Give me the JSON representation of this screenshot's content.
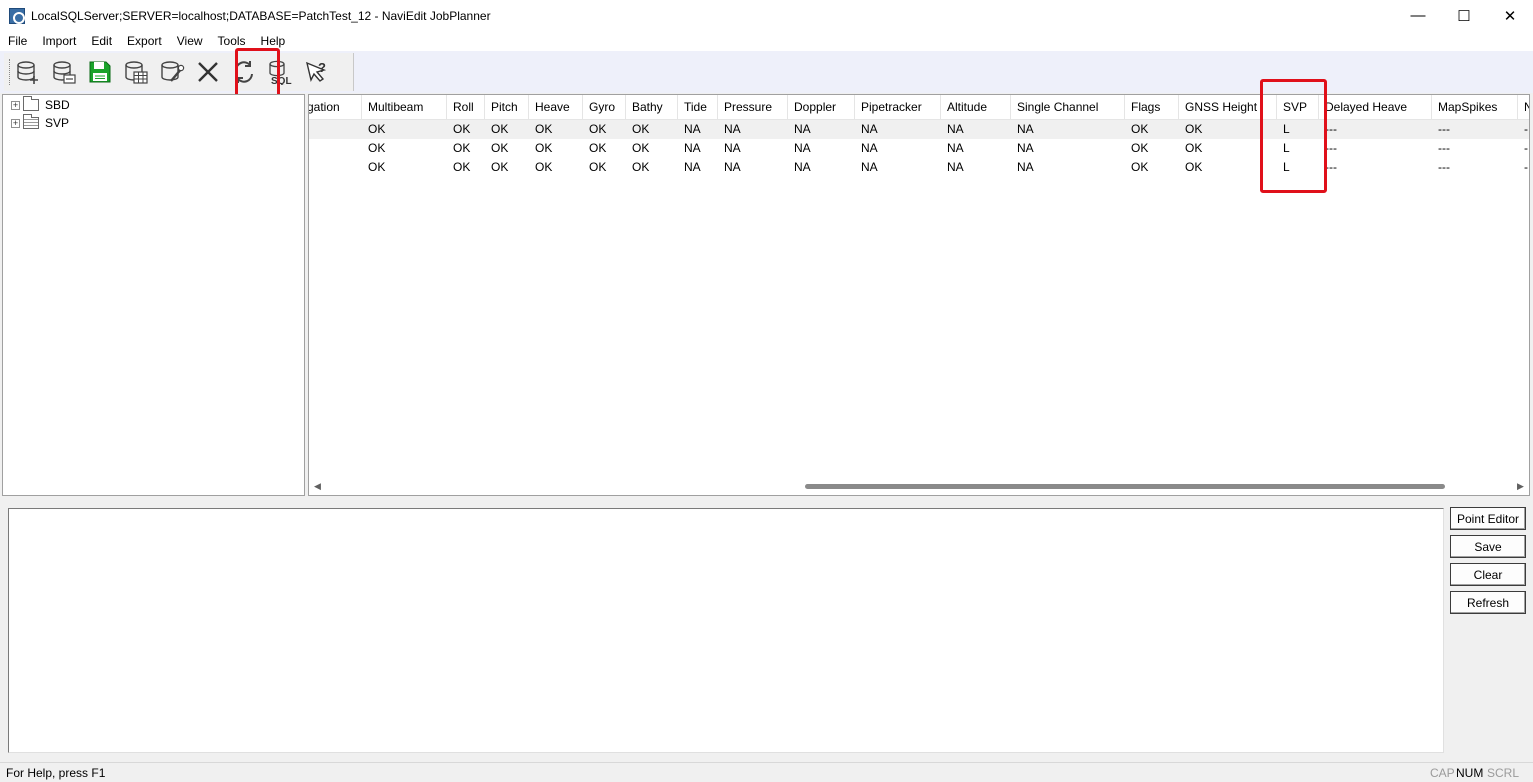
{
  "window": {
    "title": "LocalSQLServer;SERVER=localhost;DATABASE=PatchTest_12 - NaviEdit JobPlanner",
    "minimize_glyph": "—",
    "maximize_glyph": "☐",
    "close_glyph": "✕"
  },
  "menu": {
    "items": [
      {
        "label": "File"
      },
      {
        "label": "Import"
      },
      {
        "label": "Edit"
      },
      {
        "label": "Export"
      },
      {
        "label": "View"
      },
      {
        "label": "Tools"
      },
      {
        "label": "Help"
      }
    ]
  },
  "toolbar": {
    "buttons": [
      {
        "icon": "database-add-icon"
      },
      {
        "icon": "database-connect-icon"
      },
      {
        "icon": "save-icon"
      },
      {
        "icon": "database-table-icon"
      },
      {
        "icon": "database-tools-icon"
      },
      {
        "icon": "delete-icon"
      },
      {
        "icon": "refresh-icon",
        "highlighted": true
      },
      {
        "icon": "sql-icon"
      },
      {
        "icon": "context-help-icon"
      }
    ],
    "highlight_color": "#e0101a"
  },
  "tree": {
    "nodes": [
      {
        "label": "SBD",
        "expander": "+"
      },
      {
        "label": "SVP",
        "expander": "+"
      }
    ]
  },
  "grid": {
    "columns": [
      "gation",
      "Multibeam",
      "Roll",
      "Pitch",
      "Heave",
      "Gyro",
      "Bathy",
      "Tide",
      "Pressure",
      "Doppler",
      "Pipetracker",
      "Altitude",
      "Single Channel",
      "Flags",
      "GNSS Height",
      "SVP",
      "Delayed Heave",
      "MapSpikes",
      "N"
    ],
    "rows": [
      [
        "",
        "OK",
        "OK",
        "OK",
        "OK",
        "OK",
        "OK",
        "NA",
        "NA",
        "NA",
        "NA",
        "NA",
        "NA",
        "OK",
        "OK",
        "L",
        "---",
        "---",
        "-"
      ],
      [
        "",
        "OK",
        "OK",
        "OK",
        "OK",
        "OK",
        "OK",
        "NA",
        "NA",
        "NA",
        "NA",
        "NA",
        "NA",
        "OK",
        "OK",
        "L",
        "---",
        "---",
        "-"
      ],
      [
        "",
        "OK",
        "OK",
        "OK",
        "OK",
        "OK",
        "OK",
        "NA",
        "NA",
        "NA",
        "NA",
        "NA",
        "NA",
        "OK",
        "OK",
        "L",
        "---",
        "---",
        "-"
      ]
    ],
    "scroll_left_arrow": "◀",
    "scroll_right_arrow": "▶"
  },
  "side_buttons": {
    "point_editor": "Point Editor",
    "save": "Save",
    "clear": "Clear",
    "refresh": "Refresh"
  },
  "status": {
    "help_text": "For Help, press F1",
    "cap": "CAP",
    "num": "NUM",
    "scrl": "SCRL"
  }
}
